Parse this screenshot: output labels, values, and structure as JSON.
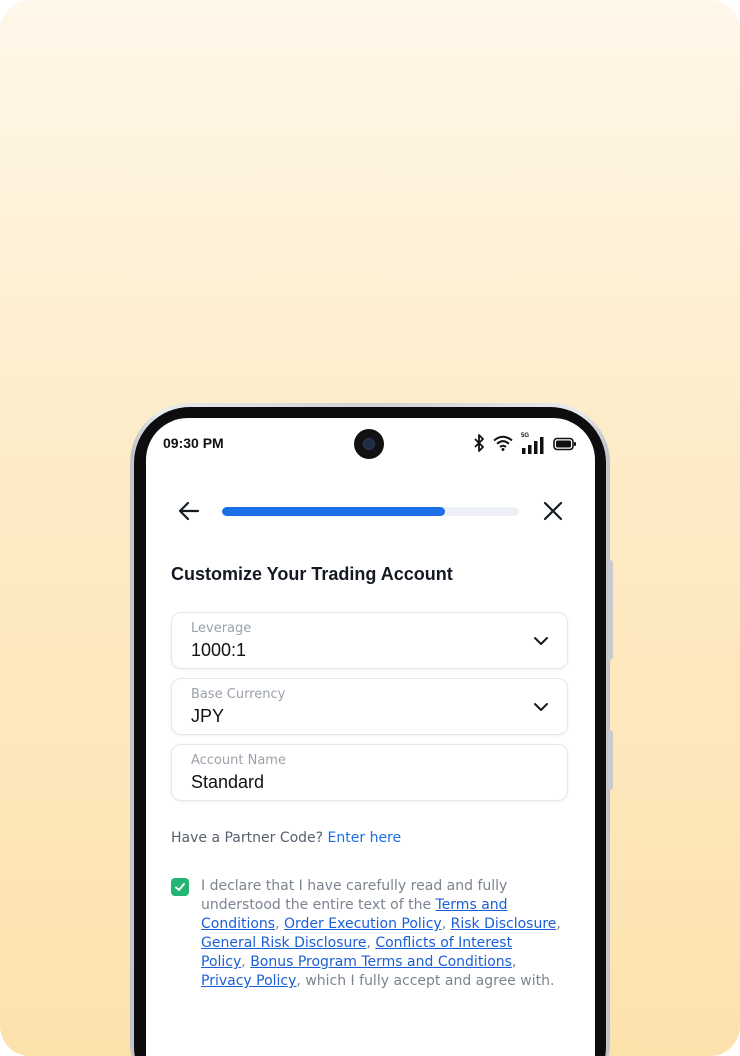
{
  "status_bar": {
    "time": "09:30 PM",
    "network_label": "5G",
    "icons": [
      "bluetooth-icon",
      "wifi-icon",
      "signal-icon",
      "battery-icon"
    ]
  },
  "progress": {
    "fraction": 0.75
  },
  "form": {
    "title": "Customize Your Trading Account",
    "leverage": {
      "label": "Leverage",
      "value": "1000:1"
    },
    "base_currency": {
      "label": "Base Currency",
      "value": "JPY"
    },
    "account_name": {
      "label": "Account Name",
      "value": "Standard"
    }
  },
  "partner": {
    "prompt": "Have a Partner Code?",
    "link": "Enter here"
  },
  "declaration": {
    "checked": true,
    "intro": "I declare that I have carefully read and fully understood the entire text of the ",
    "links": {
      "terms": "Terms and Conditions",
      "order_execution": "Order Execution Policy",
      "risk_disclosure": "Risk Disclosure",
      "general_risk": "General Risk Disclosure",
      "conflicts": "Conflicts of Interest Policy",
      "bonus": "Bonus Program Terms and Conditions",
      "privacy": "Privacy Policy"
    },
    "sep": ", ",
    "outro": ", which I fully accept and agree with."
  },
  "colors": {
    "accent": "#1b6ee6",
    "checkbox": "#22b573",
    "background_top": "#fff7ea",
    "background_bottom": "#fde2ae"
  }
}
